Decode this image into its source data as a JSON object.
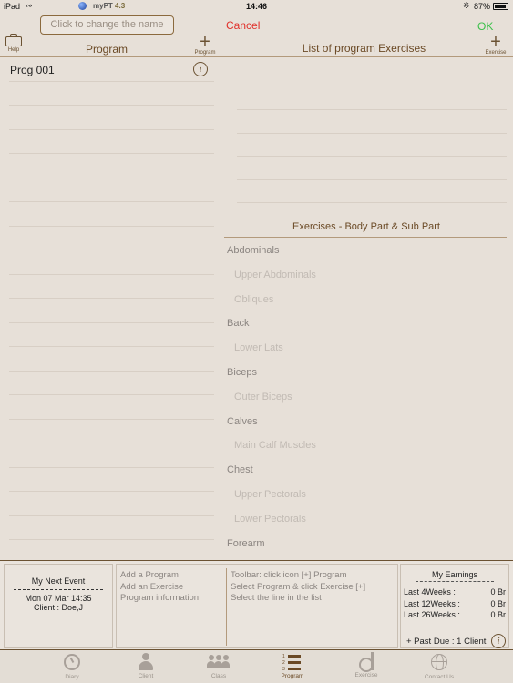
{
  "status_bar": {
    "device": "iPad",
    "app": "myPT",
    "version": "4.3",
    "time": "14:46",
    "battery": "87%"
  },
  "toolbar": {
    "name_field_placeholder": "Click to change the name",
    "cancel_label": "Cancel",
    "ok_label": "OK",
    "help_label": "Help",
    "program_title": "Program",
    "program_add_label": "Program",
    "exercises_title": "List of program Exercises",
    "exercise_add_label": "Exercise"
  },
  "programs": [
    {
      "name": "Prog 001"
    }
  ],
  "body_parts": {
    "title": "Exercises - Body Part & Sub Part",
    "items": [
      {
        "label": "Abdominals",
        "level": "part"
      },
      {
        "label": "Upper Abdominals",
        "level": "sub"
      },
      {
        "label": "Obliques",
        "level": "sub"
      },
      {
        "label": "Back",
        "level": "part"
      },
      {
        "label": "Lower Lats",
        "level": "sub"
      },
      {
        "label": "Biceps",
        "level": "part"
      },
      {
        "label": "Outer Biceps",
        "level": "sub"
      },
      {
        "label": "Calves",
        "level": "part"
      },
      {
        "label": "Main Calf Muscles",
        "level": "sub"
      },
      {
        "label": "Chest",
        "level": "part"
      },
      {
        "label": "Upper Pectorals",
        "level": "sub"
      },
      {
        "label": "Lower Pectorals",
        "level": "sub"
      },
      {
        "label": "Forearm",
        "level": "part"
      }
    ]
  },
  "next_event": {
    "title": "My Next Event",
    "date": "Mon 07 Mar  14:35",
    "client": "Client : Doe,J"
  },
  "tips": {
    "col1": [
      "Add a Program",
      "Add an Exercise",
      "Program information"
    ],
    "col2": [
      "Toolbar: click icon [+] Program",
      "Select Program & click Exercise [+]",
      "Select the line in the list"
    ]
  },
  "earnings": {
    "title": "My Earnings",
    "rows": [
      {
        "label": "Last  4Weeks :",
        "value": "0  Br"
      },
      {
        "label": "Last 12Weeks :",
        "value": "0  Br"
      },
      {
        "label": "Last 26Weeks :",
        "value": "0  Br"
      }
    ],
    "past_due": "+ Past Due : 1 Client"
  },
  "tabs": [
    {
      "label": "Diary",
      "icon": "clock-icon"
    },
    {
      "label": "Client",
      "icon": "person-icon"
    },
    {
      "label": "Class",
      "icon": "group-icon"
    },
    {
      "label": "Program",
      "icon": "numbered-list-icon",
      "active": true
    },
    {
      "label": "Exercise",
      "icon": "weightlifter-icon"
    },
    {
      "label": "Contact Us",
      "icon": "globe-icon"
    }
  ],
  "colors": {
    "accent_brown": "#6b4a26",
    "cancel_red": "#e0302a",
    "ok_green": "#3cc04a",
    "background": "#e7e0d8"
  }
}
